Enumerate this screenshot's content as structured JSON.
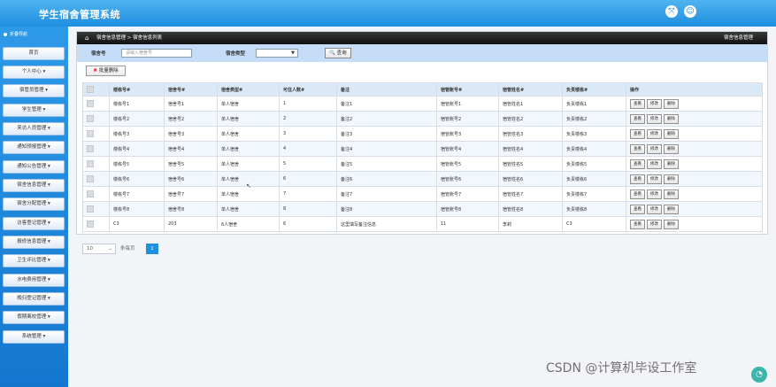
{
  "header": {
    "title": "学生宿舍管理系统"
  },
  "sidebar": {
    "top_label": "折叠导航",
    "items": [
      {
        "label": "首页"
      },
      {
        "label": "个人中心 ▾"
      },
      {
        "label": "宿管员管理 ▾"
      },
      {
        "label": "学生管理 ▾"
      },
      {
        "label": "来访人员管理 ▾"
      },
      {
        "label": "通知预报管理 ▾"
      },
      {
        "label": "通知公告管理 ▾"
      },
      {
        "label": "宿舍信息管理 ▾"
      },
      {
        "label": "宿舍分配管理 ▾"
      },
      {
        "label": "访客登记管理 ▾"
      },
      {
        "label": "报修信息管理 ▾"
      },
      {
        "label": "卫生评比管理 ▾"
      },
      {
        "label": "水电费用管理 ▾"
      },
      {
        "label": "晚归登记管理 ▾"
      },
      {
        "label": "假期离校管理 ▾"
      },
      {
        "label": "系统管理 ▾"
      }
    ]
  },
  "breadcrumb": {
    "text": "宿舍信息管理 > 宿舍信息列表",
    "right": "宿舍信息管理"
  },
  "search": {
    "dorm_no_label": "宿舍号",
    "dorm_no_placeholder": "请输入宿舍号",
    "dorm_type_label": "宿舍类型",
    "query_button": "查询"
  },
  "batch_delete_label": "批量删除",
  "table": {
    "columns": [
      "楼栋号#",
      "宿舍号#",
      "宿舍类型#",
      "可住人数#",
      "备注",
      "宿管账号#",
      "宿管姓名#",
      "负责楼栋#",
      "操作"
    ],
    "rows": [
      [
        "楼栋号1",
        "宿舍号1",
        "单人宿舍",
        "1",
        "备注1",
        "宿管账号1",
        "宿管姓名1",
        "负责楼栋1"
      ],
      [
        "楼栋号2",
        "宿舍号2",
        "单人宿舍",
        "2",
        "备注2",
        "宿管账号2",
        "宿管姓名2",
        "负责楼栋2"
      ],
      [
        "楼栋号3",
        "宿舍号3",
        "单人宿舍",
        "3",
        "备注3",
        "宿管账号3",
        "宿管姓名3",
        "负责楼栋3"
      ],
      [
        "楼栋号4",
        "宿舍号4",
        "单人宿舍",
        "4",
        "备注4",
        "宿管账号4",
        "宿管姓名4",
        "负责楼栋4"
      ],
      [
        "楼栋号5",
        "宿舍号5",
        "单人宿舍",
        "5",
        "备注5",
        "宿管账号5",
        "宿管姓名5",
        "负责楼栋5"
      ],
      [
        "楼栋号6",
        "宿舍号6",
        "单人宿舍",
        "6",
        "备注6",
        "宿管账号6",
        "宿管姓名6",
        "负责楼栋6"
      ],
      [
        "楼栋号7",
        "宿舍号7",
        "单人宿舍",
        "7",
        "备注7",
        "宿管账号7",
        "宿管姓名7",
        "负责楼栋7"
      ],
      [
        "楼栋号8",
        "宿舍号8",
        "单人宿舍",
        "8",
        "备注8",
        "宿管账号8",
        "宿管姓名8",
        "负责楼栋8"
      ],
      [
        "C3",
        "203",
        "6人宿舍",
        "6",
        "这里填写备注信息",
        "11",
        "李莉",
        "C3"
      ]
    ],
    "actions": {
      "view": "查看",
      "edit": "修改",
      "delete": "删除"
    }
  },
  "pager": {
    "page_size": "10",
    "per_page_label": "条每页",
    "current_page": "1"
  },
  "watermark": "CSDN @计算机毕设工作室",
  "colors": {
    "header": "#1f8ee0",
    "sidebar": "#1477cf",
    "search_bar": "#c5ddf6",
    "page_active": "#1e8fe1"
  },
  "icons": {
    "header_left": "expand-icon",
    "header_right": "user-icon",
    "home": "home-icon",
    "query": "magnifier-icon",
    "batch_delete": "x-icon"
  }
}
